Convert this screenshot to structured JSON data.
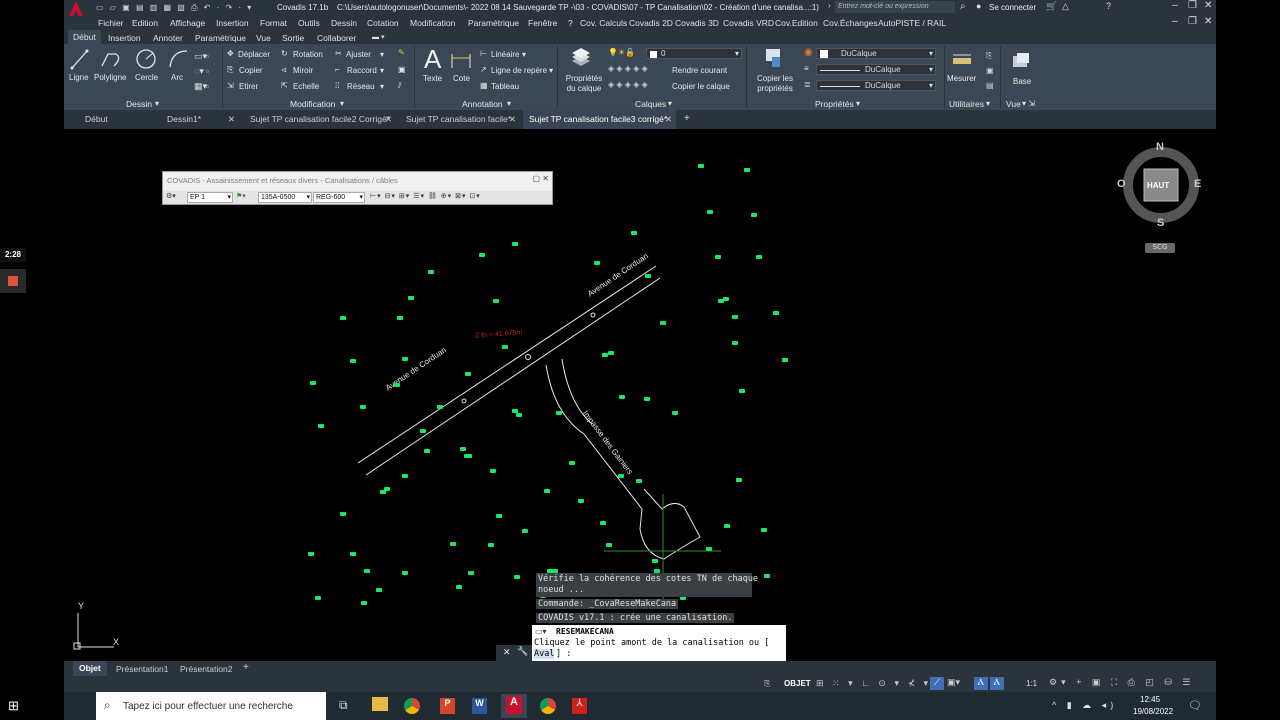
{
  "titlebar": {
    "app": "Covadis 17.1b",
    "path": "C:\\Users\\autologonuser\\Documents\\- 2022 08 14 Sauvegarde TP -\\03 - COVADIS\\07 - TP Canalisation\\02 - Création d'une canalisa...:1)",
    "search_placeholder": "Entrez mot-clé ou expression",
    "login": "Se connecter"
  },
  "menu": [
    "Fichier",
    "Edition",
    "Affichage",
    "Insertion",
    "Format",
    "Outils",
    "Dessin",
    "Cotation",
    "Modification",
    "Paramétrique",
    "Fenêtre",
    "?",
    "Cov. Calculs",
    "Covadis 2D",
    "Covadis 3D",
    "Covadis VRD",
    "Cov.Edition",
    "Cov.Échanges",
    "AutoPISTE / RAIL"
  ],
  "ribbon_tabs": [
    "Début",
    "Insertion",
    "Annoter",
    "Paramétrique",
    "Vue",
    "Sortie",
    "Collaborer"
  ],
  "ribbon": {
    "dessin": {
      "title": "Dessin",
      "tools": [
        "Ligne",
        "Polyligne",
        "Cercle",
        "Arc"
      ]
    },
    "modification": {
      "title": "Modification",
      "items": [
        "Déplacer",
        "Rotation",
        "Ajuster",
        "Copier",
        "Miroir",
        "Raccord",
        "Etirer",
        "Echelle",
        "Réseau"
      ]
    },
    "annotation": {
      "title": "Annotation",
      "big": [
        "Texte",
        "Cote"
      ],
      "items": [
        "Linéaire",
        "Ligne de repère",
        "Tableau"
      ]
    },
    "calques": {
      "title": "Calques",
      "big": "Propriétés du calque",
      "layer_value": "0",
      "items": [
        "Rendre courant",
        "Copier le calque"
      ]
    },
    "proprietes": {
      "title": "Propriétés",
      "big": "Copier les propriétés",
      "values": [
        "DuCalque",
        "DuCalque",
        "DuCalque"
      ]
    },
    "utilitaires": {
      "title": "Utilitaires",
      "big": "Mesurer"
    },
    "vue": {
      "title": "Vue",
      "big": "Base"
    }
  },
  "doc_tabs": [
    {
      "label": "Début",
      "active": false
    },
    {
      "label": "Dessin1*",
      "active": false
    },
    {
      "label": "Sujet TP canalisation facile2 Corrigé*",
      "active": false
    },
    {
      "label": "Sujet TP canalisation facile*",
      "active": false
    },
    {
      "label": "Sujet TP canalisation facile3 corrigé*",
      "active": true
    }
  ],
  "covadis_bar": {
    "title": "COVADIS - Assainissement et réseaux divers - Canalisations / câbles",
    "fields": [
      "EP 1",
      "135A-0500",
      "REG-600"
    ]
  },
  "timer": "2:28",
  "viewcube": {
    "N": "N",
    "S": "S",
    "E": "E",
    "O": "O",
    "face": "HAUT",
    "wcs": "SCG"
  },
  "drawing": {
    "road1": "Avenue de Corduan",
    "road2": "Avenue de Corduan",
    "road3": "Impasse des Gainiers",
    "zlabel": "Z tn = 41.075m",
    "ucs_y": "Y",
    "ucs_x": "X"
  },
  "command": {
    "history": [
      "Vérifie la cohérence des cotes TN de chaque",
      "noeud ...",
      "Commande: _CovaReseMakeCana",
      "COVADIS v17.1 : crée une canalisation."
    ],
    "current": "RESEMAKECANA",
    "prompt": "Cliquez le point amont de la canalisation ou [",
    "option": "Aval",
    "end": "] :"
  },
  "layout_tabs": [
    "Objet",
    "Présentation1",
    "Présentation2",
    "+"
  ],
  "status": {
    "mode": "OBJET",
    "scale": "1:1"
  },
  "taskbar": {
    "search": "Tapez ici pour effectuer une recherche",
    "time": "12:45",
    "date": "19/08/2022"
  },
  "colors": {
    "accent": "#3c4756",
    "points": "#18e86a",
    "autocad_red": "#c8102e"
  }
}
